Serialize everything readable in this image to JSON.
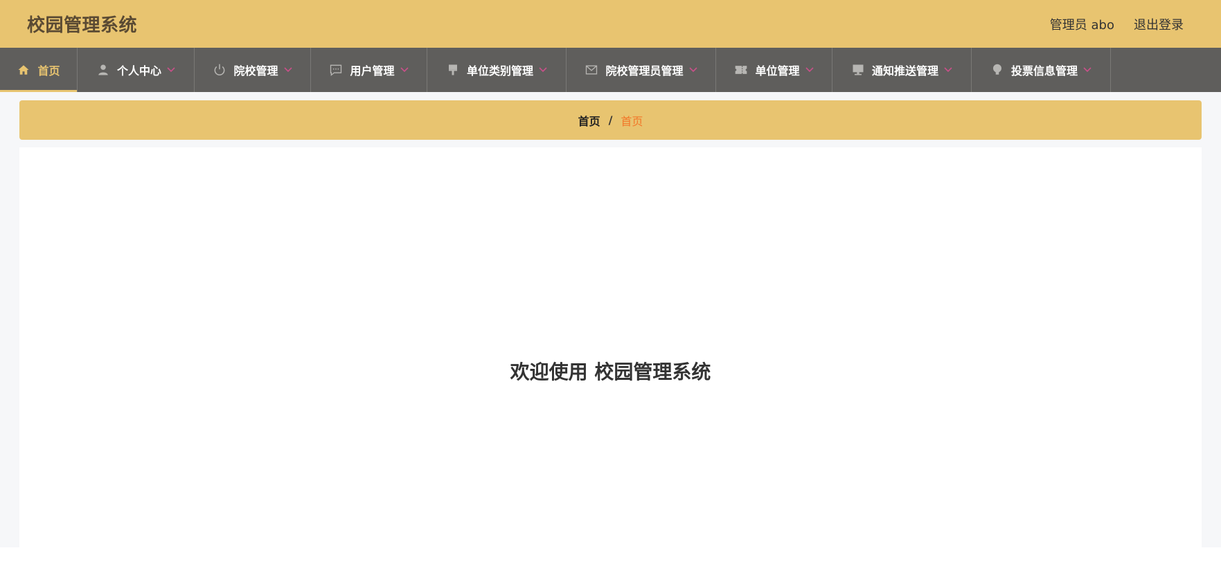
{
  "header": {
    "title": "校园管理系统",
    "admin_label": "管理员 abo",
    "logout_label": "退出登录"
  },
  "nav": {
    "items": [
      {
        "label": "首页",
        "icon": "home-icon"
      },
      {
        "label": "个人中心",
        "icon": "user-icon"
      },
      {
        "label": "院校管理",
        "icon": "power-icon"
      },
      {
        "label": "用户管理",
        "icon": "chat-icon"
      },
      {
        "label": "单位类别管理",
        "icon": "brush-icon"
      },
      {
        "label": "院校管理员管理",
        "icon": "mail-icon"
      },
      {
        "label": "单位管理",
        "icon": "ticket-icon"
      },
      {
        "label": "通知推送管理",
        "icon": "monitor-icon"
      },
      {
        "label": "投票信息管理",
        "icon": "bulb-icon"
      }
    ],
    "active_index": 0
  },
  "breadcrumb": {
    "home": "首页",
    "separator": "/",
    "current": "首页"
  },
  "main": {
    "welcome": "欢迎使用 校园管理系统"
  },
  "colors": {
    "accent": "#e8c470",
    "nav_bg": "#5f5e5c",
    "caret": "#c9508a",
    "breadcrumb_current": "#f2782a"
  }
}
